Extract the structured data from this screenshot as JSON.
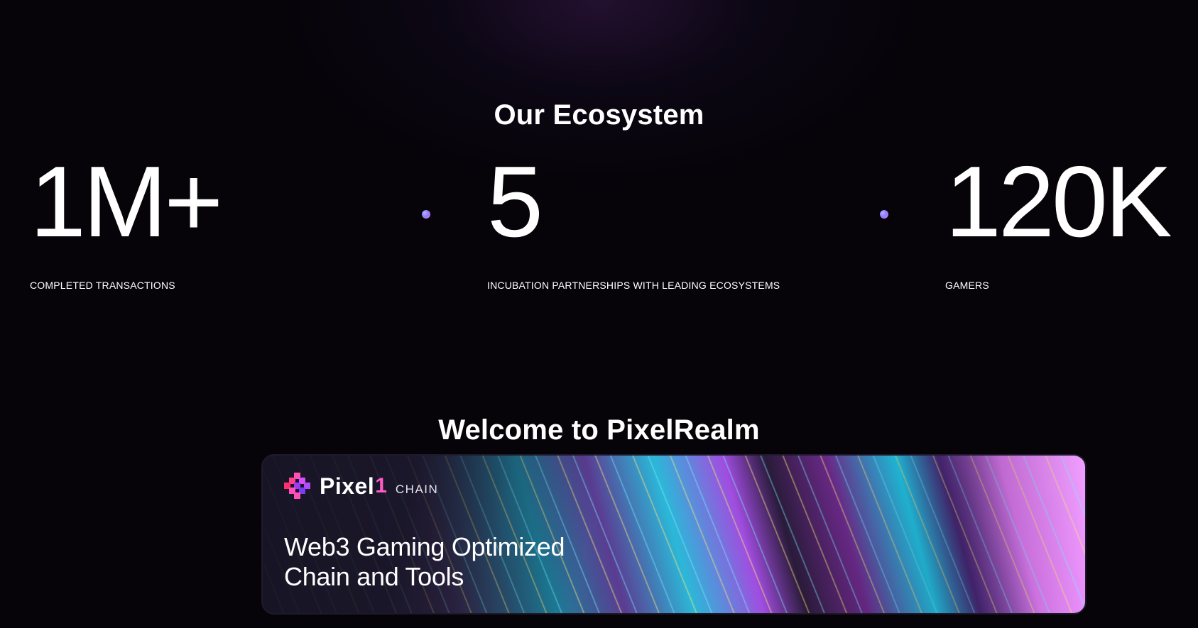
{
  "ecosystem": {
    "title": "Our Ecosystem",
    "stats": [
      {
        "value": "1M+",
        "label": "COMPLETED TRANSACTIONS"
      },
      {
        "value": "5",
        "label": "INCUBATION PARTNERSHIPS WITH LEADING ECOSYSTEMS"
      },
      {
        "value": "120K",
        "label": "GAMERS"
      }
    ]
  },
  "welcome": {
    "title": "Welcome to PixelRealm",
    "banner": {
      "brand_name": "Pixel",
      "brand_mark": "1",
      "brand_suffix": "CHAIN",
      "headline_line1": "Web3 Gaming Optimized",
      "headline_line2": "Chain and Tools",
      "logo_icon": "pixel-diamond-icon"
    }
  },
  "colors": {
    "background": "#060409",
    "accent_pink": "#ff5bc8",
    "accent_violet": "#8b7dff",
    "text": "#ffffff"
  }
}
